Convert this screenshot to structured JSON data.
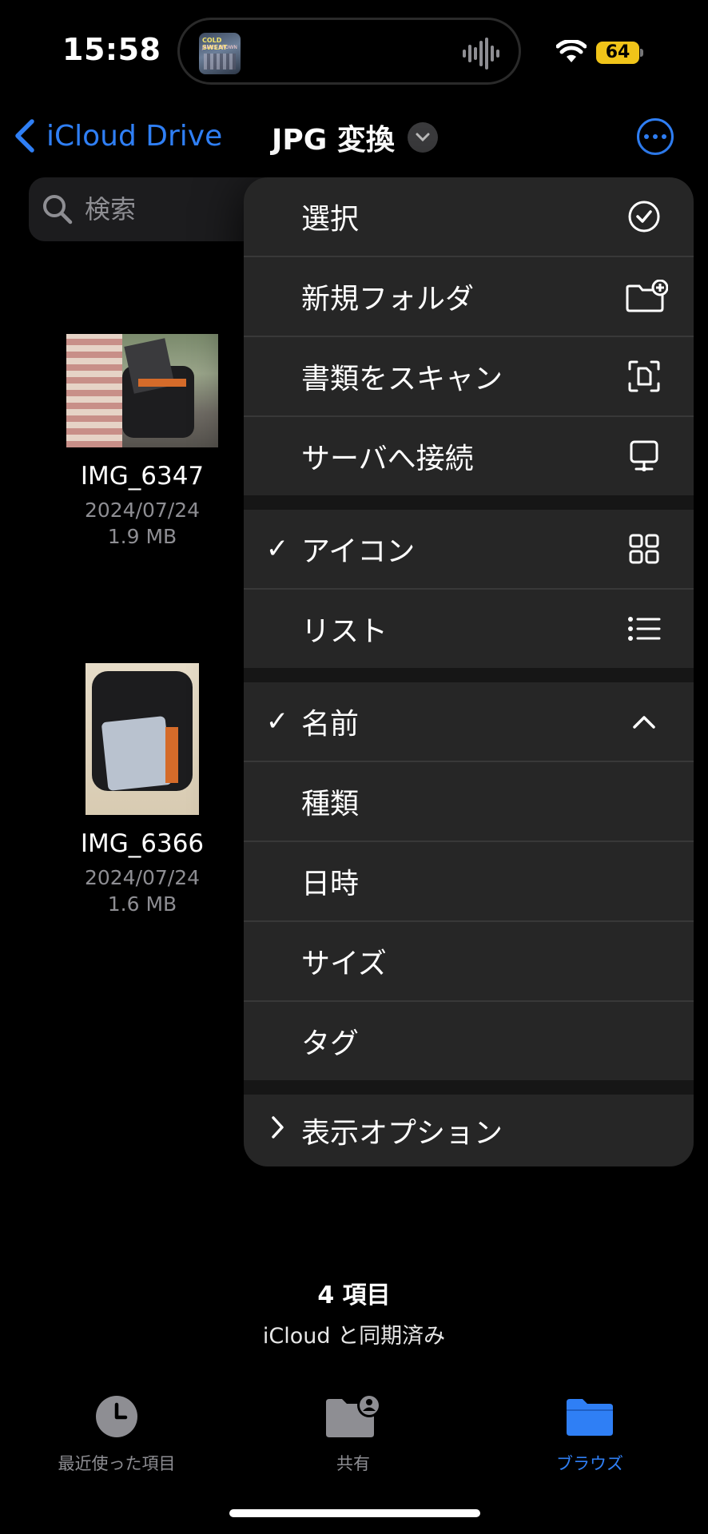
{
  "status_bar": {
    "time": "15:58",
    "battery": "64",
    "now_playing_art": {
      "line1": "COLD SWEAT",
      "line2": "JAMES BROWN"
    }
  },
  "nav": {
    "back_label": "iCloud Drive",
    "title": "JPG 変換"
  },
  "search": {
    "placeholder": "検索"
  },
  "files": [
    {
      "name": "IMG_6347",
      "date": "2024/07/24",
      "size": "1.9 MB"
    },
    {
      "name": "IMG_6366",
      "date": "2024/07/24",
      "size": "1.6 MB"
    }
  ],
  "menu": {
    "actions": [
      {
        "label": "選択",
        "icon": "checkmark-circle-icon"
      },
      {
        "label": "新規フォルダ",
        "icon": "folder-badge-plus-icon"
      },
      {
        "label": "書類をスキャン",
        "icon": "doc-viewfinder-icon"
      },
      {
        "label": "サーバへ接続",
        "icon": "desktop-computer-icon"
      }
    ],
    "view_modes": [
      {
        "label": "アイコン",
        "icon": "grid-icon",
        "checked": true
      },
      {
        "label": "リスト",
        "icon": "list-icon",
        "checked": false
      }
    ],
    "sort": [
      {
        "label": "名前",
        "checked": true,
        "icon": "chevron-up-icon"
      },
      {
        "label": "種類",
        "checked": false
      },
      {
        "label": "日時",
        "checked": false
      },
      {
        "label": "サイズ",
        "checked": false
      },
      {
        "label": "タグ",
        "checked": false
      }
    ],
    "view_options": {
      "label": "表示オプション"
    }
  },
  "footer": {
    "item_count": "4 項目",
    "sync_status": "iCloud と同期済み"
  },
  "tabbar": {
    "recents": "最近使った項目",
    "shared": "共有",
    "browse": "ブラウズ"
  },
  "colors": {
    "accent": "#2f7ff5",
    "background": "#000000",
    "menu_bg": "#262626",
    "battery": "#f0c419"
  }
}
